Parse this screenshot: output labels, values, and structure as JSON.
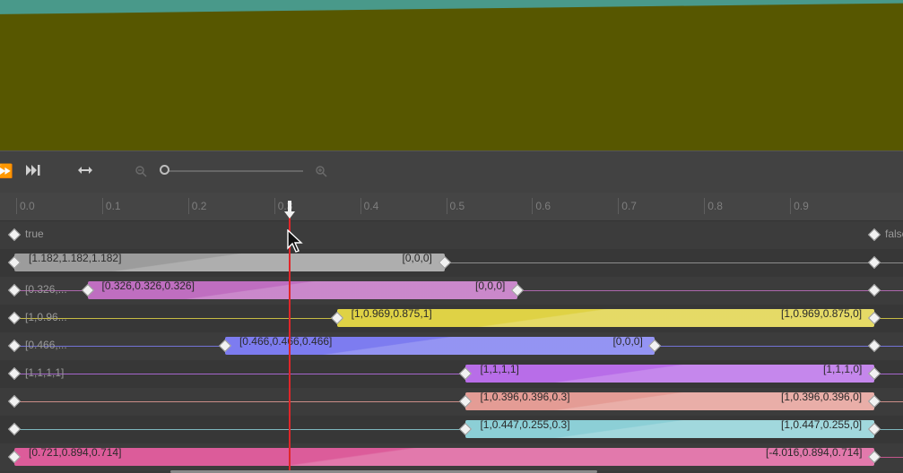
{
  "toolbar": {
    "buttons": [
      {
        "name": "step-back-icon",
        "glyph": "⏵"
      },
      {
        "name": "skip-to-end-icon",
        "glyph": "⏭"
      },
      {
        "name": "fit-width-icon",
        "glyph": "⟷"
      },
      {
        "name": "zoom-out-icon",
        "glyph": "🔍"
      },
      {
        "name": "zoom-in-icon",
        "glyph": "🔍"
      }
    ],
    "zoom_level": 0.0
  },
  "ruler": {
    "ticks": [
      "0.0",
      "0.1",
      "0.2",
      "0.3",
      "0.4",
      "0.5",
      "0.6",
      "0.7",
      "0.8",
      "0.9"
    ],
    "playhead_time": 0.32
  },
  "tracks": [
    {
      "row_label": "true",
      "end_label": "false",
      "bar": null,
      "keys": [
        0.0,
        1.0
      ]
    },
    {
      "row_label": "",
      "bar": {
        "start": 0.0,
        "end": 0.5,
        "start_label": "[1.182,1.182,1.182]",
        "end_label": "[0,0,0]",
        "color": "#9c9c9c"
      },
      "keys": [
        0.0,
        0.5,
        1.0
      ]
    },
    {
      "row_label": "[0.326,...",
      "bar": {
        "start": 0.085,
        "end": 0.585,
        "start_label": "[0.326,0.326,0.326]",
        "end_label": "[0,0,0]",
        "color": "#bf6ec0"
      },
      "keys": [
        0.0,
        0.085,
        0.585,
        1.0
      ]
    },
    {
      "row_label": "[1,0.96...",
      "bar": {
        "start": 0.375,
        "end": 1.0,
        "start_label": "[1,0.969,0.875,1]",
        "end_label": "[1,0.969,0.875,0]",
        "color": "#dfd245"
      },
      "keys": [
        0.0,
        0.375,
        1.0
      ]
    },
    {
      "row_label": "[0.466,...",
      "bar": {
        "start": 0.245,
        "end": 0.745,
        "start_label": "[0.466,0.466,0.466]",
        "end_label": "[0,0,0]",
        "color": "#7d7cf0"
      },
      "keys": [
        0.0,
        0.245,
        0.745,
        1.0
      ]
    },
    {
      "row_label": "[1,1,1,1]",
      "bar": {
        "start": 0.525,
        "end": 1.0,
        "start_label": "[1,1,1,1]",
        "end_label": "[1,1,1,0]",
        "color": "#b86de8"
      },
      "keys": [
        0.0,
        0.525,
        1.0
      ]
    },
    {
      "row_label": "",
      "bar": {
        "start": 0.525,
        "end": 1.0,
        "start_label": "[1,0.396,0.396,0.3]",
        "end_label": "[1,0.396,0.396,0]",
        "color": "#e49c95"
      },
      "keys": [
        0.0,
        0.525,
        1.0
      ]
    },
    {
      "row_label": "",
      "bar": {
        "start": 0.525,
        "end": 1.0,
        "start_label": "[1,0.447,0.255,0.3]",
        "end_label": "[1,0.447,0.255,0]",
        "color": "#8ccfd6"
      },
      "keys": [
        0.0,
        0.525,
        1.0
      ]
    },
    {
      "row_label": "",
      "bar": {
        "start": 0.0,
        "end": 1.0,
        "start_label": "[0.721,0.894,0.714]",
        "end_label": "[-4.016,0.894,0.714]",
        "color": "#dc5c9a"
      },
      "keys": [
        0.0,
        1.0
      ]
    }
  ]
}
